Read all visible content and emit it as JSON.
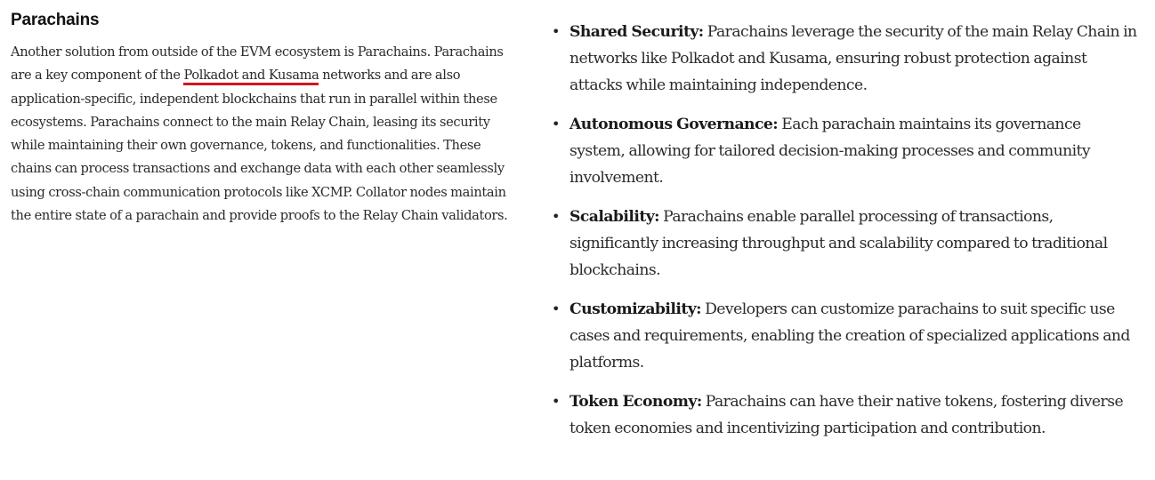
{
  "section": {
    "title": "Parachains",
    "paragraph": {
      "before_link": "Another solution from outside of the EVM ecosystem is Parachains. Parachains are a key component of the ",
      "link_text": "Polkadot and Kusama",
      "after_link": " networks and are also application-specific, independent blockchains that run in parallel within these ecosystems. Parachains connect to the main Relay Chain, leasing its security while maintaining their own governance, tokens, and functionalities. These chains can process transactions and exchange data with each other seamlessly using cross-chain communication protocols like XCMP. Collator nodes maintain the entire state of a parachain and provide proofs to the Relay Chain validators."
    },
    "link_underline_color": "#d8141a"
  },
  "features": {
    "bullet_char": "•",
    "items": [
      {
        "term": "Shared Security:",
        "text": " Parachains leverage the security of the main Relay Chain in networks like Polkadot and Kusama, ensuring robust protection against attacks while maintaining independence."
      },
      {
        "term": "Autonomous Governance:",
        "text": " Each parachain maintains its governance system, allowing for tailored decision-making processes and community involvement."
      },
      {
        "term": "Scalability:",
        "text": " Parachains enable parallel processing of transactions, significantly increasing throughput and scalability compared to traditional blockchains."
      },
      {
        "term": "Customizability:",
        "text": " Developers can customize parachains to suit specific use cases and requirements, enabling the creation of specialized applications and platforms."
      },
      {
        "term": "Token Economy:",
        "text": " Parachains can have their native tokens, fostering diverse token economies and incentivizing participation and contribution."
      }
    ]
  }
}
